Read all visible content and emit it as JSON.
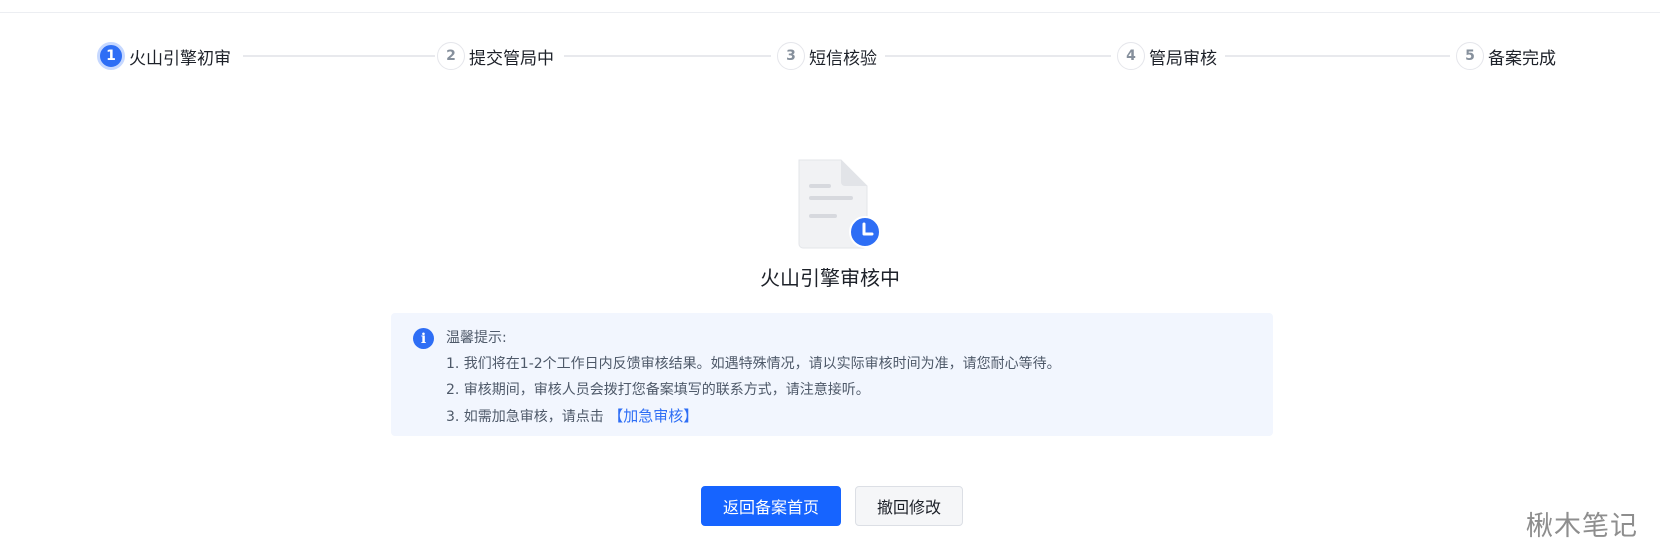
{
  "steps": [
    {
      "number": "1",
      "label": "火山引擎初审",
      "state": "active"
    },
    {
      "number": "2",
      "label": "提交管局中",
      "state": "pending"
    },
    {
      "number": "3",
      "label": "短信核验",
      "state": "pending"
    },
    {
      "number": "4",
      "label": "管局审核",
      "state": "pending"
    },
    {
      "number": "5",
      "label": "备案完成",
      "state": "pending"
    }
  ],
  "status": {
    "icon": "document-clock-icon",
    "title": "火山引擎审核中"
  },
  "tips": {
    "icon": "info-icon",
    "heading": "温馨提示:",
    "line1": "1. 我们将在1-2个工作日内反馈审核结果。如遇特殊情况，请以实际审核时间为准，请您耐心等待。",
    "line2": "2. 审核期间，审核人员会拨打您备案填写的联系方式，请注意接听。",
    "line3_prefix": "3. 如需加急审核，请点击",
    "line3_link": "【加急审核】"
  },
  "actions": {
    "primary_label": "返回备案首页",
    "secondary_label": "撤回修改"
  },
  "watermark": "楸木笔记",
  "colors": {
    "accent": "#1664ff",
    "step_active": "#2e6ef5",
    "tips_bg": "#f2f6fe"
  }
}
